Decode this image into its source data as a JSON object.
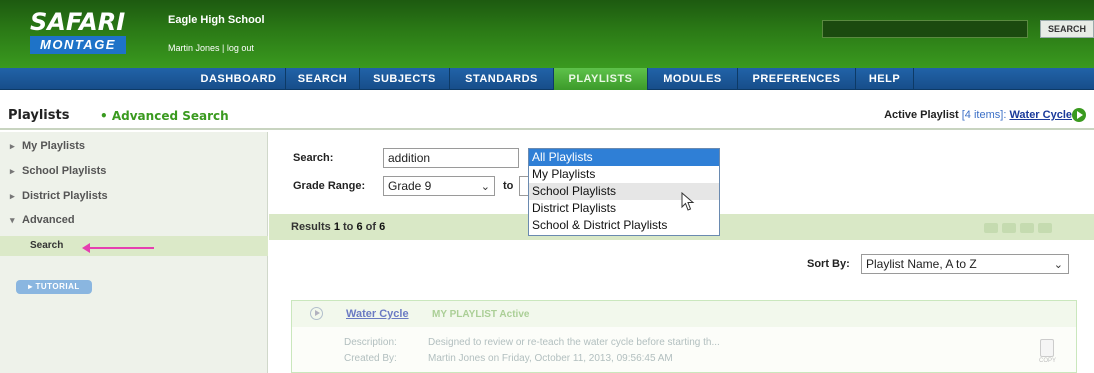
{
  "header": {
    "logo_line1": "SAFARI",
    "logo_line2": "MONTAGE",
    "school_name": "Eagle High School",
    "user_info": "Martin Jones | log out",
    "search_button": "SEARCH"
  },
  "nav": {
    "items": [
      "DASHBOARD",
      "SEARCH",
      "SUBJECTS",
      "STANDARDS",
      "PLAYLISTS",
      "MODULES",
      "PREFERENCES",
      "HELP"
    ],
    "active": "PLAYLISTS"
  },
  "title_bar": {
    "title": "Playlists",
    "subtitle": "Advanced Search",
    "active_playlist_label": "Active Playlist",
    "active_playlist_count": "[4 items]:",
    "active_playlist_name": "Water Cycle"
  },
  "sidebar": {
    "items": [
      {
        "label": "My Playlists",
        "arrow": "▸"
      },
      {
        "label": "School Playlists",
        "arrow": "▸"
      },
      {
        "label": "District Playlists",
        "arrow": "▸"
      },
      {
        "label": "Advanced",
        "arrow": "▾"
      }
    ],
    "active_sub": "Search",
    "tutorial": "▸ TUTORIAL"
  },
  "form": {
    "search_label": "Search:",
    "search_value": "addition",
    "grade_label": "Grade Range:",
    "grade_from": "Grade 9",
    "to_label": "to",
    "scope_options": [
      "All Playlists",
      "My Playlists",
      "School Playlists",
      "District Playlists",
      "School & District Playlists"
    ],
    "scope_selected": "All Playlists",
    "scope_hover": "School Playlists"
  },
  "results": {
    "prefix": "Results",
    "from": "1",
    "to_word": "to",
    "to": "6",
    "of_word": "of",
    "total": "6"
  },
  "sort": {
    "label": "Sort By:",
    "value": "Playlist Name, A to Z"
  },
  "playlist_card": {
    "title": "Water Cycle",
    "tag": "MY PLAYLIST  Active",
    "description_label": "Description:",
    "description": "Designed to review or re-teach the water cycle before starting th...",
    "created_label": "Created By:",
    "created": "Martin Jones on Friday, October 11, 2013, 09:56:45 AM",
    "copy_label": "COPY"
  },
  "colors": {
    "header_green": "#2b7a16",
    "nav_blue": "#174e8a",
    "nav_active": "#5ec24a",
    "dropdown_selected": "#2f7fd6",
    "annotation_arrow": "#e53fb0"
  }
}
